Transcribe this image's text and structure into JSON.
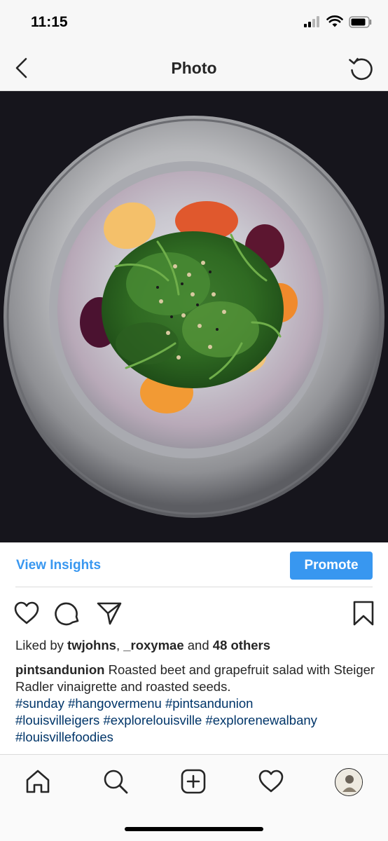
{
  "status_bar": {
    "time": "11:15",
    "icons": [
      "signal-icon",
      "wifi-icon",
      "battery-icon"
    ]
  },
  "nav": {
    "title": "Photo",
    "back_icon": "chevron-left-icon",
    "right_icon": "refresh-icon"
  },
  "photo": {
    "description_icon": "post-photo"
  },
  "insights": {
    "view_label": "View Insights",
    "promote_label": "Promote"
  },
  "actions": {
    "icons": [
      "heart-icon",
      "comment-icon",
      "share-icon",
      "bookmark-icon"
    ]
  },
  "likes": {
    "prefix": "Liked by ",
    "user1": "twjohns",
    "sep": ", ",
    "user2": "_roxymae",
    "and": " and ",
    "others": "48 others"
  },
  "caption": {
    "username": "pintsandunion",
    "text": " Roasted beet and grapefruit salad with Steiger Radler vinaigrette and roasted seeds.",
    "hashtags": [
      "#sunday",
      "#hangovermenu",
      "#pintsandunion",
      "#louisvilleigers",
      "#explorelouisville",
      "#explorenewalbany",
      "#louisvillefoodies"
    ]
  },
  "tab_bar": {
    "items": [
      "home-icon",
      "search-icon",
      "add-post-icon",
      "activity-heart-icon",
      "profile-avatar"
    ]
  },
  "colors": {
    "accent": "#3897f0",
    "hashtag": "#003569",
    "text": "#262626",
    "bar_bg": "#f7f7f7"
  }
}
